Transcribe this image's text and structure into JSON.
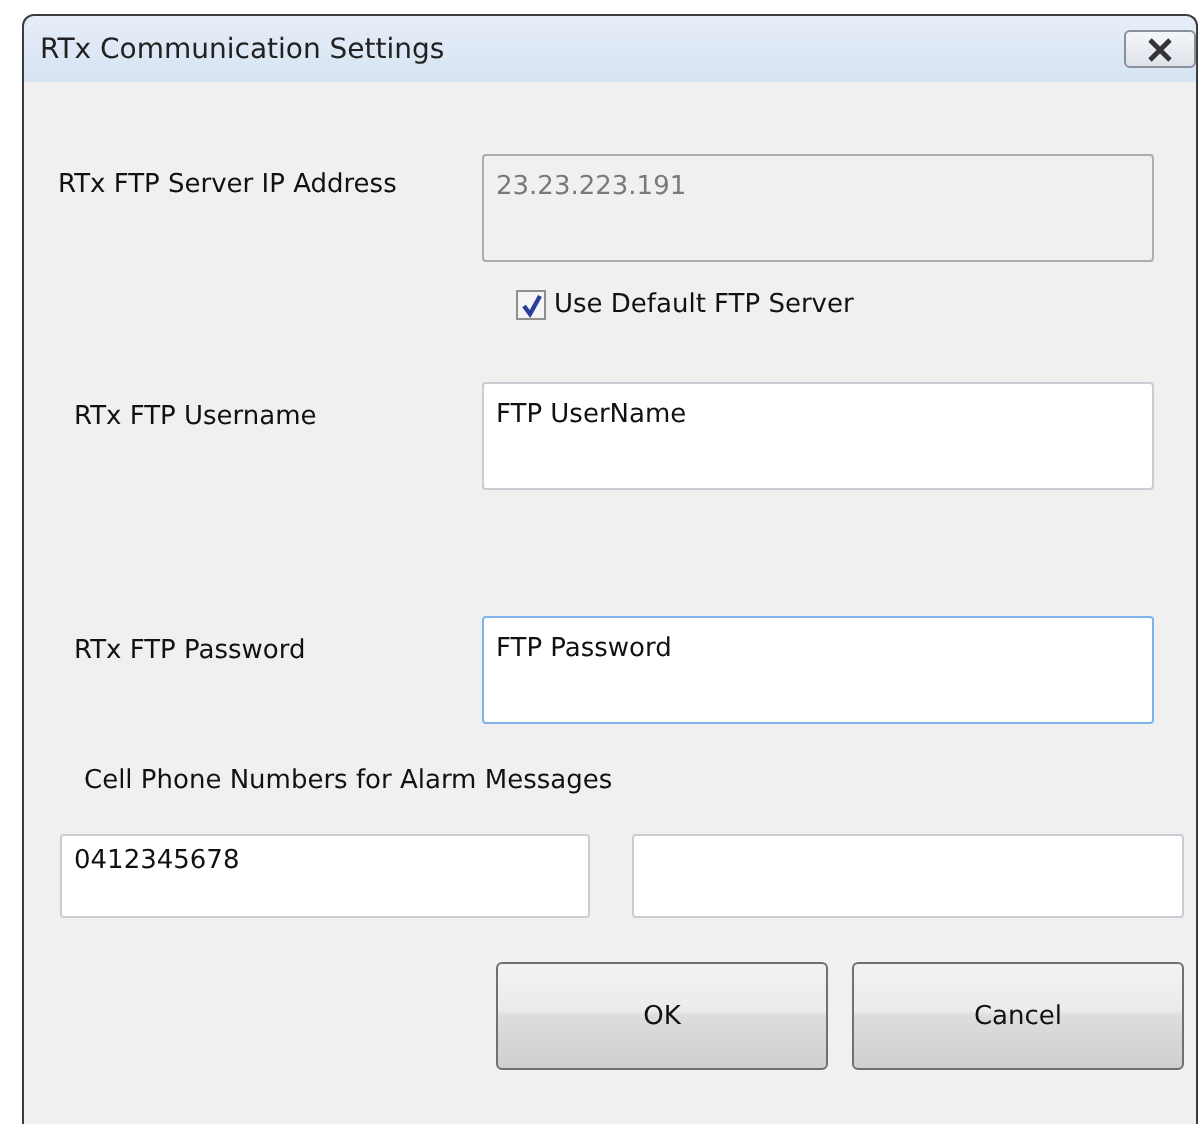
{
  "window": {
    "title": "RTx Communication Settings"
  },
  "server_ip": {
    "label": "RTx FTP Server IP Address",
    "value": "23.23.223.191",
    "disabled": true,
    "focused": false
  },
  "use_default_ftp_server": {
    "label": "Use Default FTP Server",
    "checked": true
  },
  "username": {
    "label": "RTx FTP Username",
    "value": "FTP UserName",
    "disabled": false,
    "focused": false
  },
  "password": {
    "label": "RTx FTP Password",
    "value": "FTP Password",
    "disabled": false,
    "focused": true
  },
  "alarm_phones": {
    "label": "Cell Phone Numbers for Alarm Messages",
    "fields": [
      {
        "value": "0412345678",
        "focused": false
      },
      {
        "focused": false
      }
    ]
  },
  "buttons": [
    "OK",
    "Cancel"
  ]
}
